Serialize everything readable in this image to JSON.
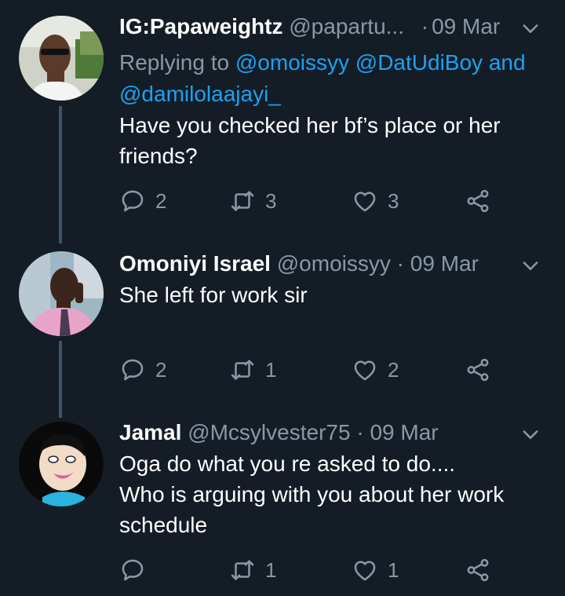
{
  "tweets": [
    {
      "name": "IG:Papaweightz",
      "handle": "@papartu...",
      "separator": "·",
      "date": "09 Mar",
      "replying_prefix": "Replying to",
      "replying_mentions": [
        "@omoissyy",
        "@DatUdiBoy"
      ],
      "replying_and": "and",
      "replying_last": "@damilolaajayi_",
      "text_lines": [
        "Have you checked her bf’s place or her",
        "friends?"
      ],
      "replies": "2",
      "retweets": "3",
      "likes": "3"
    },
    {
      "name": "Omoniyi Israel",
      "handle": "@omoissyy",
      "separator": "·",
      "date": "09 Mar",
      "text_lines": [
        "She left for work sir"
      ],
      "replies": "2",
      "retweets": "1",
      "likes": "2"
    },
    {
      "name": "Jamal",
      "handle": "@Mcsylvester75",
      "separator": "·",
      "date": "09 Mar",
      "text_lines": [
        "Oga do what you re asked to do....",
        "Who is arguing with you about her work",
        "schedule"
      ],
      "replies": "",
      "retweets": "1",
      "likes": "1"
    }
  ],
  "colors": {
    "background": "#141d26",
    "secondary_text": "#8899a6",
    "link": "#1da1f2",
    "thread_line": "#3d5466"
  },
  "icons": [
    "reply-icon",
    "retweet-icon",
    "like-icon",
    "share-icon",
    "chevron-down-icon"
  ]
}
